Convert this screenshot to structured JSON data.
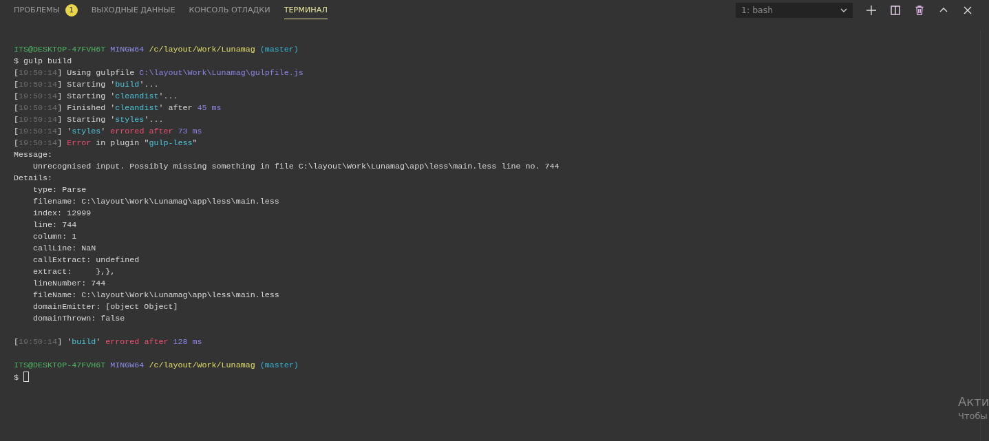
{
  "tabs": [
    {
      "label": "ПРОБЛЕМЫ",
      "selected": false,
      "badge": "1"
    },
    {
      "label": "ВЫХОДНЫЕ ДАННЫЕ",
      "selected": false
    },
    {
      "label": "КОНСОЛЬ ОТЛАДКИ",
      "selected": false
    },
    {
      "label": "ТЕРМИНАЛ",
      "selected": true
    }
  ],
  "terminal_select": {
    "value": "1: bash"
  },
  "actions": [
    {
      "kind": "plus"
    },
    {
      "kind": "split"
    },
    {
      "kind": "trash"
    },
    {
      "kind": "up"
    },
    {
      "kind": "close"
    }
  ],
  "lines": [
    {
      "kind": "text",
      "segments": [
        {
          "text": "ITS@DESKTOP-47FVH6T ",
          "kind": "user"
        },
        {
          "text": "MINGW64 ",
          "kind": "host"
        },
        {
          "text": "/c/layout/Work/Lunamag ",
          "kind": "path"
        },
        {
          "text": "(master)",
          "kind": "branch"
        }
      ]
    },
    {
      "kind": "text",
      "segments": [
        {
          "text": "$ gulp build",
          "kind": "plain"
        }
      ]
    },
    {
      "kind": "text",
      "segments": [
        {
          "text": "[",
          "kind": "plain"
        },
        {
          "text": "19:50:14",
          "kind": "dim"
        },
        {
          "text": "] Using gulpfile ",
          "kind": "plain"
        },
        {
          "text": "C:\\layout\\Work\\Lunamag\\gulpfile.js",
          "kind": "number"
        }
      ]
    },
    {
      "kind": "text",
      "segments": [
        {
          "text": "[",
          "kind": "plain"
        },
        {
          "text": "19:50:14",
          "kind": "dim"
        },
        {
          "text": "] Starting '",
          "kind": "plain"
        },
        {
          "text": "build",
          "kind": "string"
        },
        {
          "text": "'...",
          "kind": "plain"
        }
      ]
    },
    {
      "kind": "text",
      "segments": [
        {
          "text": "[",
          "kind": "plain"
        },
        {
          "text": "19:50:14",
          "kind": "dim"
        },
        {
          "text": "] Starting '",
          "kind": "plain"
        },
        {
          "text": "cleandist",
          "kind": "string"
        },
        {
          "text": "'...",
          "kind": "plain"
        }
      ]
    },
    {
      "kind": "text",
      "segments": [
        {
          "text": "[",
          "kind": "plain"
        },
        {
          "text": "19:50:14",
          "kind": "dim"
        },
        {
          "text": "] Finished '",
          "kind": "plain"
        },
        {
          "text": "cleandist",
          "kind": "string"
        },
        {
          "text": "' after ",
          "kind": "plain"
        },
        {
          "text": "45 ms",
          "kind": "number"
        }
      ]
    },
    {
      "kind": "text",
      "segments": [
        {
          "text": "[",
          "kind": "plain"
        },
        {
          "text": "19:50:14",
          "kind": "dim"
        },
        {
          "text": "] Starting '",
          "kind": "plain"
        },
        {
          "text": "styles",
          "kind": "string"
        },
        {
          "text": "'...",
          "kind": "plain"
        }
      ]
    },
    {
      "kind": "text",
      "segments": [
        {
          "text": "[",
          "kind": "plain"
        },
        {
          "text": "19:50:14",
          "kind": "dim"
        },
        {
          "text": "] '",
          "kind": "plain"
        },
        {
          "text": "styles",
          "kind": "string"
        },
        {
          "text": "' ",
          "kind": "plain"
        },
        {
          "text": "errored after ",
          "kind": "error"
        },
        {
          "text": "73 ms",
          "kind": "number"
        }
      ]
    },
    {
      "kind": "text",
      "segments": [
        {
          "text": "[",
          "kind": "plain"
        },
        {
          "text": "19:50:14",
          "kind": "dim"
        },
        {
          "text": "] ",
          "kind": "plain"
        },
        {
          "text": "Error",
          "kind": "error"
        },
        {
          "text": " in plugin \"",
          "kind": "plain"
        },
        {
          "text": "gulp-less",
          "kind": "string"
        },
        {
          "text": "\"",
          "kind": "plain"
        }
      ]
    },
    {
      "kind": "text",
      "segments": [
        {
          "text": "Message:",
          "kind": "plain"
        }
      ]
    },
    {
      "kind": "text",
      "segments": [
        {
          "text": "    Unrecognised input. Possibly missing something in file C:\\layout\\Work\\Lunamag\\app\\less\\main.less line no. 744",
          "kind": "plain"
        }
      ]
    },
    {
      "kind": "text",
      "segments": [
        {
          "text": "Details:",
          "kind": "plain"
        }
      ]
    },
    {
      "kind": "text",
      "segments": [
        {
          "text": "    type: Parse",
          "kind": "plain"
        }
      ]
    },
    {
      "kind": "text",
      "segments": [
        {
          "text": "    filename: C:\\layout\\Work\\Lunamag\\app\\less\\main.less",
          "kind": "plain"
        }
      ]
    },
    {
      "kind": "text",
      "segments": [
        {
          "text": "    index: 12999",
          "kind": "plain"
        }
      ]
    },
    {
      "kind": "text",
      "segments": [
        {
          "text": "    line: 744",
          "kind": "plain"
        }
      ]
    },
    {
      "kind": "text",
      "segments": [
        {
          "text": "    column: 1",
          "kind": "plain"
        }
      ]
    },
    {
      "kind": "text",
      "segments": [
        {
          "text": "    callLine: NaN",
          "kind": "plain"
        }
      ]
    },
    {
      "kind": "text",
      "segments": [
        {
          "text": "    callExtract: undefined",
          "kind": "plain"
        }
      ]
    },
    {
      "kind": "text",
      "segments": [
        {
          "text": "    extract:     },},",
          "kind": "plain"
        }
      ]
    },
    {
      "kind": "text",
      "segments": [
        {
          "text": "    lineNumber: 744",
          "kind": "plain"
        }
      ]
    },
    {
      "kind": "text",
      "segments": [
        {
          "text": "    fileName: C:\\layout\\Work\\Lunamag\\app\\less\\main.less",
          "kind": "plain"
        }
      ]
    },
    {
      "kind": "text",
      "segments": [
        {
          "text": "    domainEmitter: [object Object]",
          "kind": "plain"
        }
      ]
    },
    {
      "kind": "text",
      "segments": [
        {
          "text": "    domainThrown: false",
          "kind": "plain"
        }
      ]
    },
    {
      "kind": "blank"
    },
    {
      "kind": "text",
      "segments": [
        {
          "text": "[",
          "kind": "plain"
        },
        {
          "text": "19:50:14",
          "kind": "dim"
        },
        {
          "text": "] '",
          "kind": "plain"
        },
        {
          "text": "build",
          "kind": "string"
        },
        {
          "text": "' ",
          "kind": "plain"
        },
        {
          "text": "errored after ",
          "kind": "error"
        },
        {
          "text": "128 ms",
          "kind": "number"
        }
      ]
    },
    {
      "kind": "blank"
    },
    {
      "kind": "text",
      "segments": [
        {
          "text": "ITS@DESKTOP-47FVH6T ",
          "kind": "user"
        },
        {
          "text": "MINGW64 ",
          "kind": "host"
        },
        {
          "text": "/c/layout/Work/Lunamag ",
          "kind": "path"
        },
        {
          "text": "(master)",
          "kind": "branch"
        }
      ]
    },
    {
      "kind": "text",
      "cursor": true,
      "segments": [
        {
          "text": "$ ",
          "kind": "plain"
        }
      ]
    }
  ],
  "os_notice": [
    "Акти",
    "Чтобы"
  ]
}
